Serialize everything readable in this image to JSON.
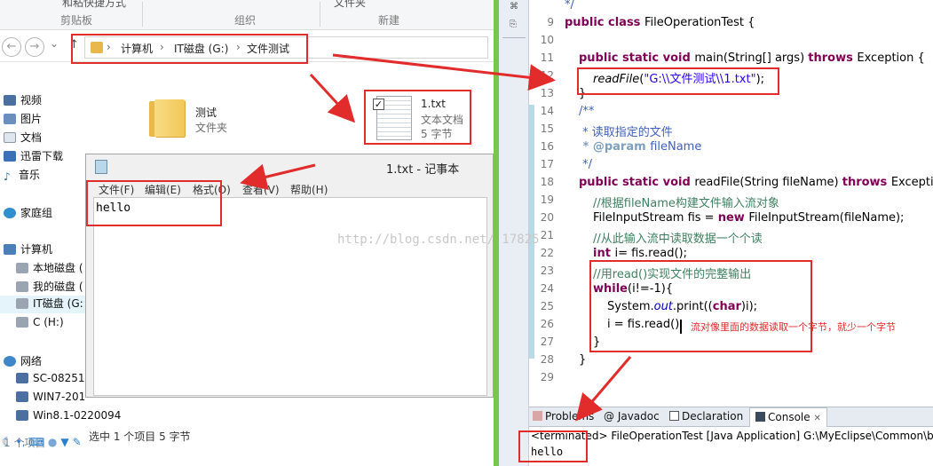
{
  "explorer": {
    "ribbon": {
      "top_fragment_left": "和粘快捷方式",
      "top_fragment_right": "文件夹",
      "groups": [
        "剪贴板",
        "组织",
        "新建"
      ]
    },
    "nav": {
      "back_glyph": "←",
      "forward_glyph": "→",
      "dropdown_glyph": "⌄",
      "up_glyph": "↑"
    },
    "address": {
      "crumbs": [
        "计算机",
        "IT磁盘 (G:)",
        "文件测试"
      ],
      "separator": "›"
    },
    "sidebar": {
      "items": [
        {
          "label": "视频",
          "icon": "video-icon"
        },
        {
          "label": "图片",
          "icon": "pictures-icon"
        },
        {
          "label": "文档",
          "icon": "documents-icon"
        },
        {
          "label": "迅雷下载",
          "icon": "download-icon"
        },
        {
          "label": "音乐",
          "icon": "music-icon"
        },
        {
          "label": "家庭组",
          "icon": "homegroup-icon"
        },
        {
          "label": "计算机",
          "icon": "computer-icon"
        },
        {
          "label": "本地磁盘 (",
          "icon": "drive-icon"
        },
        {
          "label": "我的磁盘 (",
          "icon": "drive-icon"
        },
        {
          "label": "IT磁盘 (G:",
          "icon": "drive-icon"
        },
        {
          "label": "C (H:)",
          "icon": "drive-icon"
        },
        {
          "label": "网络",
          "icon": "network-icon"
        },
        {
          "label": "SC-08251",
          "icon": "pc-icon"
        },
        {
          "label": "WIN7-201",
          "icon": "pc-icon"
        },
        {
          "label": "Win8.1-0220094",
          "icon": "pc-icon"
        }
      ]
    },
    "files": [
      {
        "name": "测试",
        "type": "文件夹"
      },
      {
        "name": "1.txt",
        "type": "文本文档",
        "size": "5 字节"
      }
    ],
    "status": {
      "left": "1 个项目",
      "right": "选中 1 个项目  5 字节"
    }
  },
  "notepad": {
    "title": "1.txt - 记事本",
    "menu": [
      "文件(F)",
      "编辑(E)",
      "格式(O)",
      "查看(V)",
      "帮助(H)"
    ],
    "content": "hello"
  },
  "editor": {
    "line_numbers": [
      "9",
      "10",
      "11",
      "12",
      "13",
      "14",
      "15",
      "16",
      "17",
      "18",
      "19",
      "20",
      "21",
      "22",
      "23",
      "24",
      "25",
      "26",
      "27",
      "28",
      "29"
    ],
    "top_partial": "*/",
    "watermark": "http://blog.csdn.net/ 17825",
    "code": {
      "l9": {
        "kw": "public class ",
        "rest": "FileOperationTest {"
      },
      "l11": {
        "kw1": "public static void ",
        "mid": "main(String[] args) ",
        "kw2": "throws ",
        "rest": "Exception {"
      },
      "l12": {
        "call": "readFile",
        "open": "(",
        "str": "\"G:\\\\文件测试\\\\1.txt\"",
        "close": ");"
      },
      "l13": "}",
      "l14": "/**",
      "l15": " * 读取指定的文件",
      "l16": {
        "tag": " * @param ",
        "rest": "fileName"
      },
      "l17": " */",
      "l18": {
        "kw1": "public static void ",
        "mid": "readFile(String fileName) ",
        "kw2": "throws ",
        "rest": "Exceptic"
      },
      "l19": "//根据fileName构建文件输入流对象",
      "l20": {
        "a": "FileInputStream fis = ",
        "kw": "new ",
        "b": "FileInputStream(fileName);"
      },
      "l21": "//从此输入流中读取数据一个个读",
      "l22": {
        "kw": "int ",
        "rest": "i= fis.read();"
      },
      "l23": "//用read()实现文件的完整输出",
      "l24": {
        "kw": "while",
        "rest": "(i!=-1){"
      },
      "l25": {
        "a": "System.",
        "fld": "out",
        "b": ".print((",
        "kw": "char",
        "c": ")i);"
      },
      "l26": "i = fis.read();",
      "l27": "}",
      "l28": "}"
    },
    "annotation": "流对像里面的数据读取一个字节，就少一个字节"
  },
  "console": {
    "tabs": [
      "Problems",
      "@ Javadoc",
      "Declaration",
      "Console"
    ],
    "close_glyph": "✕",
    "header": "<terminated> FileOperationTest [Java Application] G:\\MyEclipse\\Common\\bin",
    "output": "hello"
  },
  "colors": {
    "annotation_red": "#e22b2b",
    "eclipse_green": "#7dc44a",
    "keyword": "#7f0055",
    "string": "#2a00ff"
  }
}
